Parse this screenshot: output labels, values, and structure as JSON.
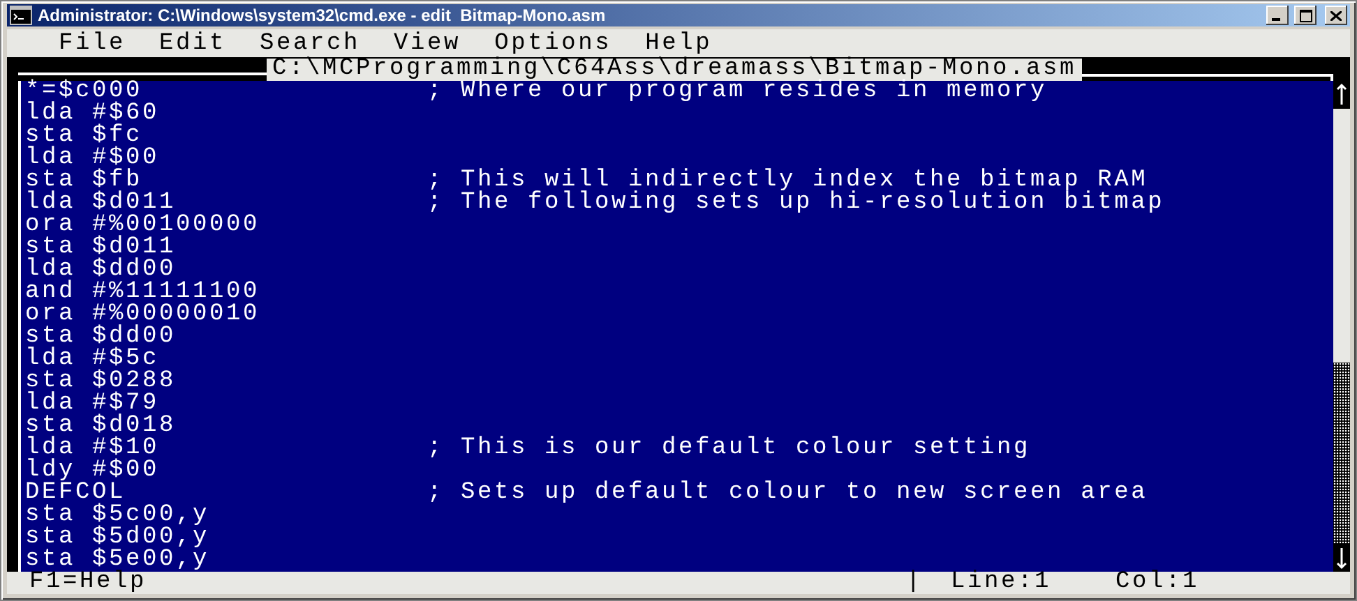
{
  "window": {
    "title": "Administrator: C:\\Windows\\system32\\cmd.exe - edit  Bitmap-Mono.asm"
  },
  "menu": [
    "File",
    "Edit",
    "Search",
    "View",
    "Options",
    "Help"
  ],
  "editor": {
    "path": "C:\\MCProgramming\\C64Ass\\dreamass\\Bitmap-Mono.asm",
    "lines": [
      {
        "code": "*=$c000",
        "comment": "; Where our program resides in memory"
      },
      {
        "code": "lda #$60"
      },
      {
        "code": "sta $fc"
      },
      {
        "code": "lda #$00"
      },
      {
        "code": "sta $fb",
        "comment": "; This will indirectly index the bitmap RAM"
      },
      {
        "code": "lda $d011",
        "comment": "; The following sets up hi-resolution bitmap"
      },
      {
        "code": "ora #%00100000"
      },
      {
        "code": "sta $d011"
      },
      {
        "code": "lda $dd00"
      },
      {
        "code": "and #%11111100"
      },
      {
        "code": "ora #%00000010"
      },
      {
        "code": "sta $dd00"
      },
      {
        "code": "lda #$5c"
      },
      {
        "code": "sta $0288"
      },
      {
        "code": "lda #$79"
      },
      {
        "code": "sta $d018"
      },
      {
        "code": "lda #$10",
        "comment": "; This is our default colour setting"
      },
      {
        "code": "ldy #$00"
      },
      {
        "code": "DEFCOL",
        "comment": "; Sets up default colour to new screen area"
      },
      {
        "code": "sta $5c00,y"
      },
      {
        "code": "sta $5d00,y"
      },
      {
        "code": "sta $5e00,y"
      }
    ]
  },
  "status_bar": {
    "help": "F1=Help",
    "separator": "|",
    "line": "Line:1",
    "column": "Col:1"
  }
}
